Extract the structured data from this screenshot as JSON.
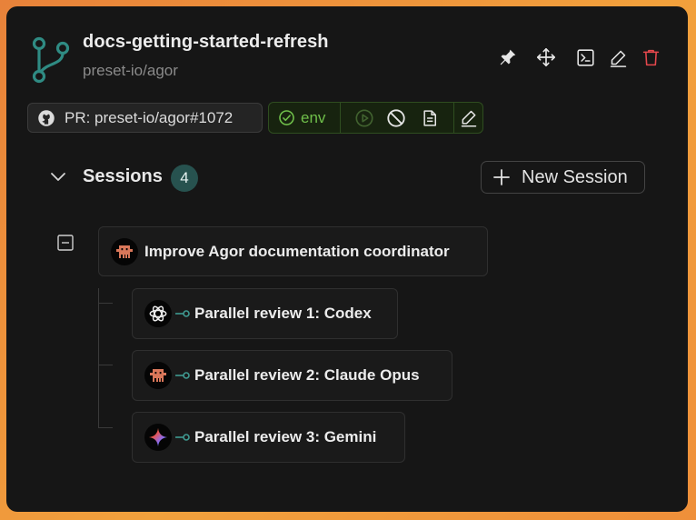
{
  "worktree": {
    "title": "docs-getting-started-refresh",
    "repo": "preset-io/agor"
  },
  "toolbar": {
    "icons": [
      "pin-icon",
      "move-icon",
      "terminal-icon",
      "edit-icon",
      "trash-icon"
    ],
    "delete_color": "#e5484d"
  },
  "pr": {
    "label": "PR: preset-io/agor#1072",
    "icon": "github-icon"
  },
  "environment": {
    "label": "env",
    "status": "running",
    "accent": "#6fbf4a",
    "actions": [
      "play-icon",
      "stop-icon",
      "logs-icon",
      "edit-env-icon"
    ]
  },
  "sessions": {
    "label": "Sessions",
    "count": "4",
    "new_button_label": "New Session",
    "parent": {
      "title": "Improve Agor documentation coordinator",
      "agent_icon": "claude-icon"
    },
    "children": [
      {
        "title": "Parallel review 1: Codex",
        "agent_icon": "openai-icon"
      },
      {
        "title": "Parallel review 2: Claude Opus",
        "agent_icon": "claude-icon"
      },
      {
        "title": "Parallel review 3: Gemini",
        "agent_icon": "gemini-icon"
      }
    ]
  }
}
